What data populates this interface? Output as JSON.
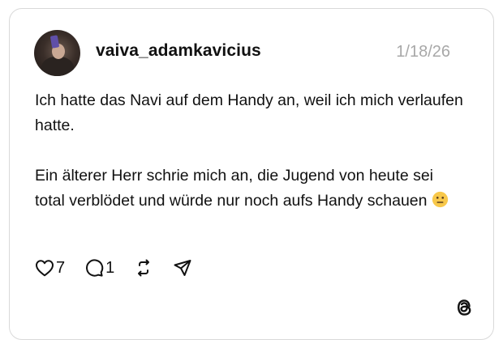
{
  "post": {
    "username": "vaiva_adamkavicius",
    "date": "1/18/26",
    "paragraph_1": "Ich hatte das Navi auf dem Handy an, weil ich mich verlaufen hatte.",
    "paragraph_2": "Ein älterer Herr schrie mich an, die Jugend von heute sei total verblödet und würde nur noch aufs Handy schauen",
    "emoji": "neutral-face-emoji"
  },
  "actions": {
    "likes": "7",
    "replies": "1",
    "icons": [
      "heart-icon",
      "comment-icon",
      "repost-icon",
      "share-icon"
    ]
  },
  "brand": {
    "logo": "threads-logo-icon"
  },
  "colors": {
    "text": "#111111",
    "muted": "#a8a8a8",
    "border": "#d9d9d9",
    "emoji": "#f8c84a"
  }
}
